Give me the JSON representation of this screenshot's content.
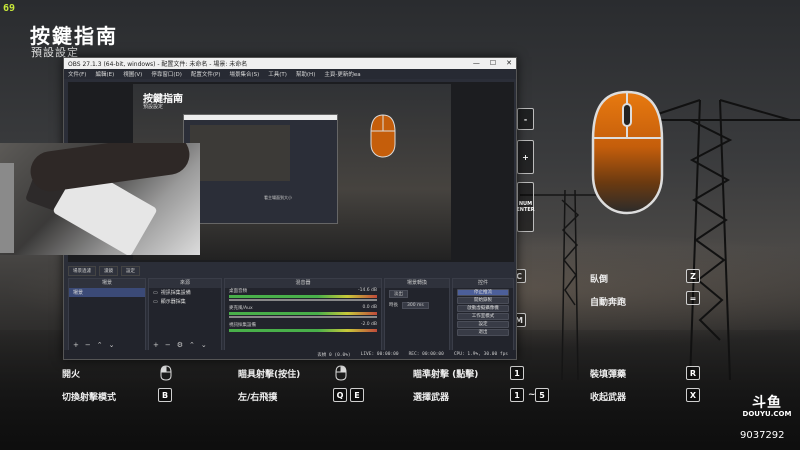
{
  "overlay": {
    "fps": "69",
    "title": "按鍵指南",
    "subtitle": "預設設定"
  },
  "keybinds": [
    {
      "label": "開火",
      "key": "mouse-left"
    },
    {
      "label": "瞄具射擊(按住)",
      "key": "mouse-right"
    },
    {
      "label": "瞄準射擊 (點擊)",
      "key": "1"
    },
    {
      "label": "裝填彈藥",
      "key": "R"
    },
    {
      "label": "切換射擊模式",
      "key": "B"
    },
    {
      "label": "左/右飛撲",
      "key_a": "Q",
      "key_b": "E"
    },
    {
      "label": "選擇武器",
      "key_a": "1",
      "sep": "~",
      "key_b": "5"
    },
    {
      "label": "收起武器",
      "key": "X"
    },
    {
      "label": "臥倒",
      "key": "Z"
    },
    {
      "label": "自動奔跑",
      "key": "="
    }
  ],
  "side_keys": {
    "k1": "-",
    "k2": "+",
    "k3_line1": "NUM",
    "k3_line2": "ENTER",
    "c": "C",
    "m": "M"
  },
  "watermark": {
    "logo": "斗鱼",
    "brand": "DOUYU.COM",
    "room_id": "9037292"
  },
  "obs": {
    "window_title": "OBS 27.1.3 (64-bit, windows) - 配置文件: 未命名 - 場景: 未命名",
    "menu": [
      "文件(F)",
      "編輯(E)",
      "視圖(V)",
      "停靠窗口(D)",
      "配置文件(P)",
      "場景集合(S)",
      "工具(T)",
      "幫助(H)",
      "主頁-更新的ea"
    ],
    "window_controls": [
      "—",
      "☐",
      "✕"
    ],
    "preview_title": "按鍵指南",
    "preview_subtitle": "預設設定",
    "preview_caption": "看主場面到大小",
    "tabs": [
      "場景過濾",
      "濾鏡",
      "設定"
    ],
    "docks": {
      "scenes": {
        "header": "場景",
        "items": [
          "場景"
        ]
      },
      "sources": {
        "header": "來源",
        "items": [
          "視訊採集設備",
          "顯示器採集"
        ]
      },
      "mixer": {
        "header": "混音器",
        "channels": [
          {
            "name": "桌面音頻",
            "db": "-14.6 dB"
          },
          {
            "name": "麥克風/Aux",
            "db": "0.0 dB"
          },
          {
            "name": "視訊採集設備",
            "db": "-2.0 dB"
          }
        ]
      },
      "transitions": {
        "header": "場景轉換",
        "type": "淡出",
        "duration_label": "時長",
        "duration": "300 ms"
      },
      "controls": {
        "header": "控件",
        "buttons": [
          "停止推流",
          "開始錄製",
          "啟動虛擬攝像機",
          "工作室模式",
          "設定",
          "退出"
        ]
      }
    },
    "status": {
      "dropped": "丟幀 0 (0.0%)",
      "live": "LIVE: 00:00:00",
      "rec": "REC: 00:00:00",
      "cpu": "CPU: 1.9%, 30.00 fps"
    }
  }
}
